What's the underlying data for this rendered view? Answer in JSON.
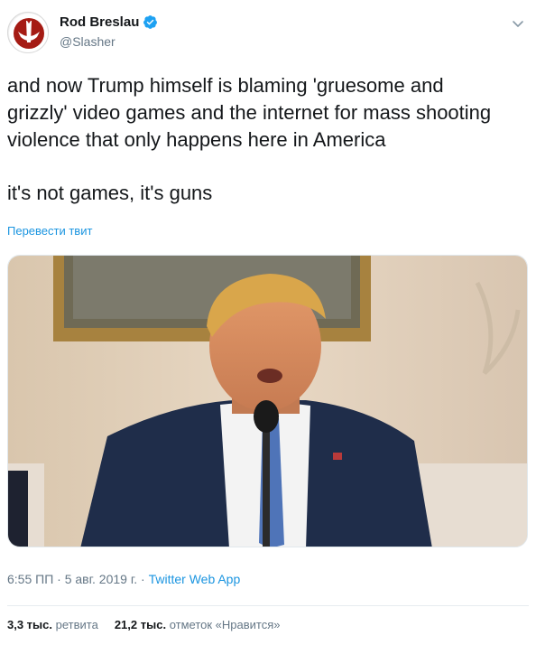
{
  "author": {
    "display_name": "Rod Breslau",
    "handle": "@Slasher"
  },
  "tweet": {
    "line1": "and now Trump himself is blaming 'gruesome and",
    "line2": "grizzly' video games and the internet for mass shooting",
    "line3": "violence that only happens here in America",
    "line4": "it's not games, it's guns"
  },
  "translate_label": "Перевести твит",
  "meta": {
    "time": "6:55 ПП",
    "sep1": " · ",
    "date": "5 авг. 2019 г.",
    "sep2": " · ",
    "app": "Twitter Web App"
  },
  "stats": {
    "retweets_count": "3,3 тыс.",
    "retweets_label": "ретвита",
    "likes_count": "21,2 тыс.",
    "likes_label": "отметок «Нравится»"
  },
  "colors": {
    "link": "#1b95e0",
    "secondary": "#657786",
    "text": "#14171a",
    "verified": "#1da1f2"
  },
  "icons": [
    "avatar-logo",
    "verified-badge-icon",
    "chevron-down-icon"
  ]
}
